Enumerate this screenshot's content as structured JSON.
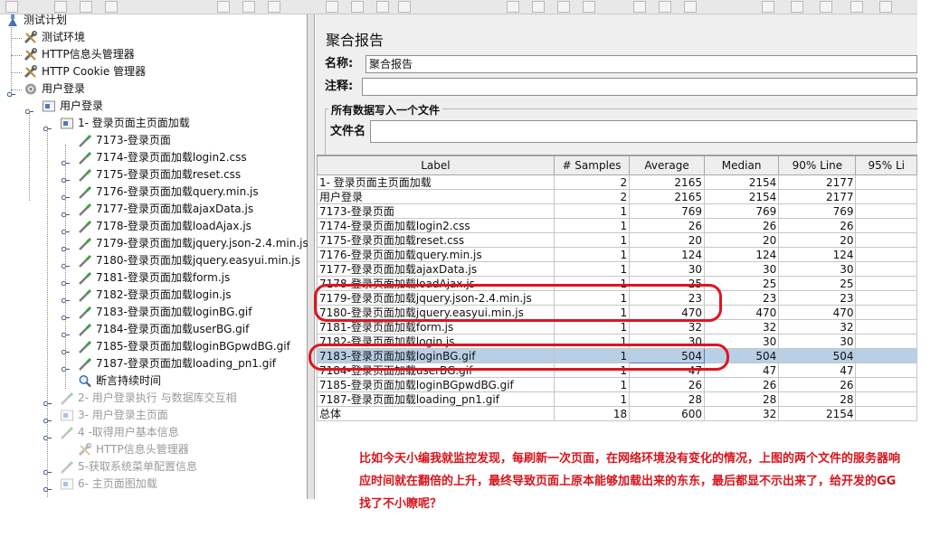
{
  "tree": {
    "nodes": [
      {
        "label": "测试计划",
        "icon": "test-plan-icon",
        "dim": false
      },
      {
        "label": "测试环境",
        "icon": "wrench-icon",
        "dim": false
      },
      {
        "label": "HTTP信息头管理器",
        "icon": "wrench-icon",
        "dim": false
      },
      {
        "label": "HTTP Cookie 管理器",
        "icon": "wrench-icon",
        "dim": false
      },
      {
        "label": "用户登录",
        "icon": "gear-icon",
        "dim": false
      },
      {
        "label": "用户登录",
        "icon": "controller-icon",
        "dim": false
      },
      {
        "label": "1- 登录页面主页面加载",
        "icon": "controller-icon",
        "dim": false
      },
      {
        "label": "7173-登录页面",
        "icon": "pipette-icon",
        "dim": false
      },
      {
        "label": "7174-登录页面加载login2.css",
        "icon": "pipette-icon",
        "dim": false
      },
      {
        "label": "7175-登录页面加载reset.css",
        "icon": "pipette-icon",
        "dim": false
      },
      {
        "label": "7176-登录页面加载query.min.js",
        "icon": "pipette-icon",
        "dim": false
      },
      {
        "label": "7177-登录页面加载ajaxData.js",
        "icon": "pipette-icon",
        "dim": false
      },
      {
        "label": "7178-登录页面加载loadAjax.js",
        "icon": "pipette-icon",
        "dim": false
      },
      {
        "label": "7179-登录页面加载jquery.json-2.4.min.js",
        "icon": "pipette-icon",
        "dim": false
      },
      {
        "label": "7180-登录页面加载jquery.easyui.min.js",
        "icon": "pipette-icon",
        "dim": false
      },
      {
        "label": "7181-登录页面加载form.js",
        "icon": "pipette-icon",
        "dim": false
      },
      {
        "label": "7182-登录页面加载login.js",
        "icon": "pipette-icon",
        "dim": false
      },
      {
        "label": "7183-登录页面加载loginBG.gif",
        "icon": "pipette-icon",
        "dim": false
      },
      {
        "label": "7184-登录页面加载userBG.gif",
        "icon": "pipette-icon",
        "dim": false
      },
      {
        "label": "7185-登录页面加载loginBGpwdBG.gif",
        "icon": "pipette-icon",
        "dim": false
      },
      {
        "label": "7187-登录页面加载loading_pn1.gif",
        "icon": "pipette-icon",
        "dim": false
      },
      {
        "label": "断言持续时间",
        "icon": "magnifier-icon",
        "dim": false
      },
      {
        "label": "2- 用户登录执行 与数据库交互相",
        "icon": "pipette-icon",
        "dim": true
      },
      {
        "label": "3- 用户登录主页面",
        "icon": "controller-icon",
        "dim": true
      },
      {
        "label": "4 -取得用户基本信息",
        "icon": "pipette-icon",
        "dim": true
      },
      {
        "label": "HTTP信息头管理器",
        "icon": "wrench-icon",
        "dim": true
      },
      {
        "label": "5-获取系统菜单配置信息",
        "icon": "pipette-icon",
        "dim": true
      },
      {
        "label": "6- 主页面图加载",
        "icon": "controller-icon",
        "dim": true
      }
    ]
  },
  "panel": {
    "title": "聚合报告",
    "name_label": "名称:",
    "name_value": "聚合报告",
    "comment_label": "注释:",
    "comment_value": "",
    "group_legend": "所有数据写入一个文件",
    "file_label": "文件名",
    "file_value": ""
  },
  "table": {
    "headers": [
      "Label",
      "# Samples",
      "Average",
      "Median",
      "90% Line",
      "95% Li"
    ],
    "rows": [
      [
        "1- 登录页面主页面加载",
        "2",
        "2165",
        "2154",
        "2177",
        ""
      ],
      [
        "用户登录",
        "2",
        "2165",
        "2154",
        "2177",
        ""
      ],
      [
        "7173-登录页面",
        "1",
        "769",
        "769",
        "769",
        ""
      ],
      [
        "7174-登录页面加载login2.css",
        "1",
        "26",
        "26",
        "26",
        ""
      ],
      [
        "7175-登录页面加载reset.css",
        "1",
        "20",
        "20",
        "20",
        ""
      ],
      [
        "7176-登录页面加载query.min.js",
        "1",
        "124",
        "124",
        "124",
        ""
      ],
      [
        "7177-登录页面加载ajaxData.js",
        "1",
        "30",
        "30",
        "30",
        ""
      ],
      [
        "7178-登录页面加载loadAjax.js",
        "1",
        "25",
        "25",
        "25",
        ""
      ],
      [
        "7179-登录页面加载jquery.json-2.4.min.js",
        "1",
        "23",
        "23",
        "23",
        ""
      ],
      [
        "7180-登录页面加载jquery.easyui.min.js",
        "1",
        "470",
        "470",
        "470",
        ""
      ],
      [
        "7181-登录页面加载form.js",
        "1",
        "32",
        "32",
        "32",
        ""
      ],
      [
        "7182-登录页面加载login.js",
        "1",
        "30",
        "30",
        "30",
        ""
      ],
      [
        "7183-登录页面加载loginBG.gif",
        "1",
        "504",
        "504",
        "504",
        ""
      ],
      [
        "7184-登录页面加载userBG.gif",
        "1",
        "47",
        "47",
        "47",
        ""
      ],
      [
        "7185-登录页面加载loginBGpwdBG.gif",
        "1",
        "26",
        "26",
        "26",
        ""
      ],
      [
        "7187-登录页面加载loading_pn1.gif",
        "1",
        "28",
        "28",
        "28",
        ""
      ],
      [
        "总体",
        "18",
        "600",
        "32",
        "2154",
        ""
      ]
    ],
    "selected_row": 12
  },
  "annotation": {
    "text": "比如今天小编我就监控发现，每刷新一次页面，在网络环境没有变化的情况，上图的两个文件的服务器响应时间就在翻倍的上升，最终导致页面上原本能够加载出来的东东，最后都显不示出来了，给开发的GG找了不小瞭呢？",
    "color": "#e0141e"
  }
}
